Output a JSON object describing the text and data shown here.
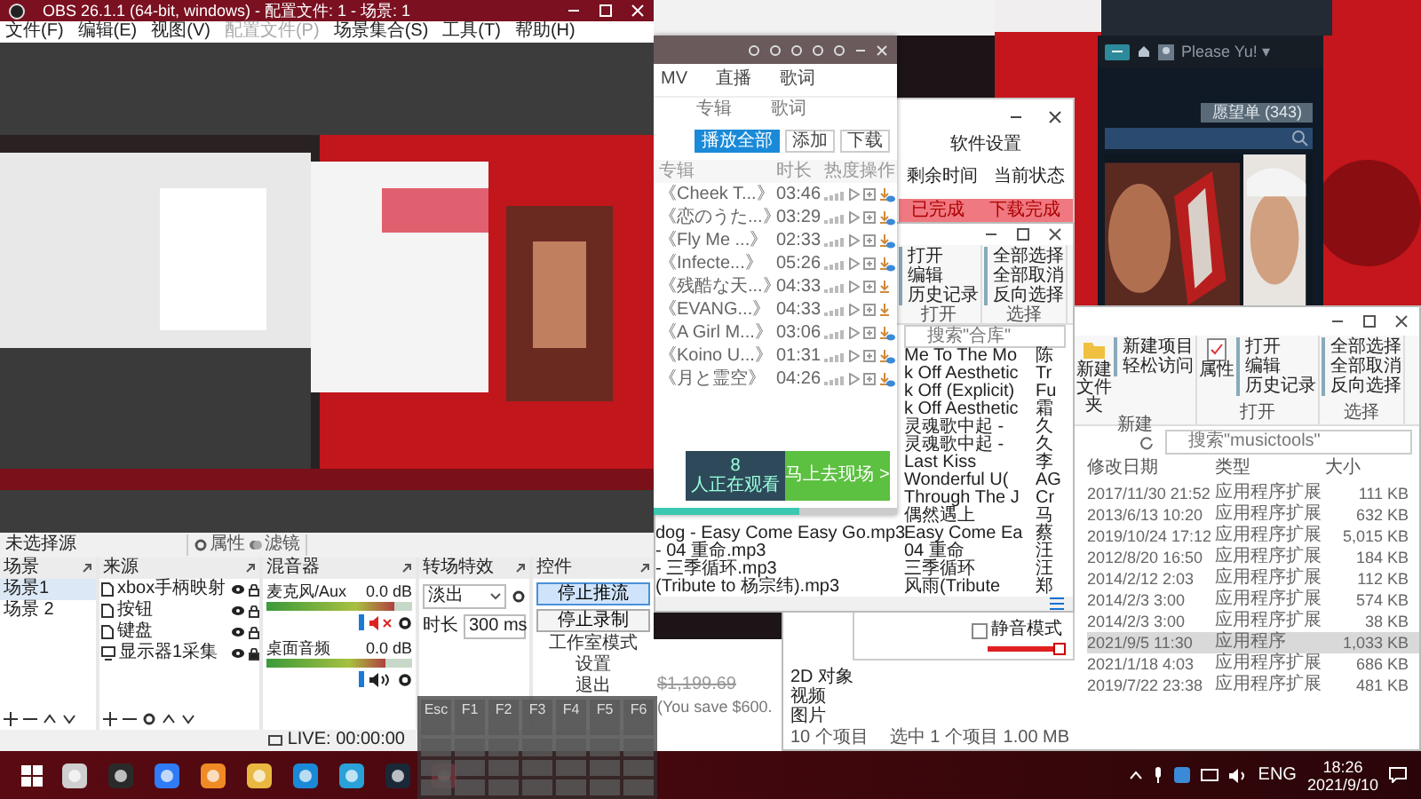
{
  "obs": {
    "title": "OBS 26.1.1 (64-bit, windows) - 配置文件: 1 - 场景: 1",
    "menu": [
      {
        "label": "文件(F)",
        "disabled": false
      },
      {
        "label": "编辑(E)",
        "disabled": false
      },
      {
        "label": "视图(V)",
        "disabled": false
      },
      {
        "label": "配置文件(P)",
        "disabled": true
      },
      {
        "label": "场景集合(S)",
        "disabled": false
      },
      {
        "label": "工具(T)",
        "disabled": false
      },
      {
        "label": "帮助(H)",
        "disabled": false
      }
    ],
    "source_toolbar": {
      "label": "未选择源",
      "properties": "属性",
      "filters": "滤镜"
    },
    "scenes": {
      "title": "场景",
      "items": [
        {
          "label": "场景1",
          "selected": true
        },
        {
          "label": "场景 2",
          "selected": false
        }
      ]
    },
    "sources": {
      "title": "来源",
      "items": [
        {
          "label": "xbox手柄映射",
          "kind": "file",
          "locked": false
        },
        {
          "label": "按钮",
          "kind": "file",
          "locked": false
        },
        {
          "label": "键盘",
          "kind": "file",
          "locked": false
        },
        {
          "label": "显示器1采集",
          "kind": "monitor",
          "locked": true
        }
      ]
    },
    "mixer": {
      "title": "混音器",
      "channels": [
        {
          "name": "麦克风/Aux",
          "reading": "0.0 dB",
          "level": 0.88,
          "muted": true
        },
        {
          "name": "桌面音频",
          "reading": "0.0 dB",
          "level": 0.82,
          "muted": false
        }
      ]
    },
    "transitions": {
      "title": "转场特效",
      "effect": "淡出",
      "duration_label": "时长",
      "duration": "300 ms"
    },
    "controls": {
      "title": "控件",
      "buttons": [
        {
          "label": "停止推流",
          "selected": true
        },
        {
          "label": "停止录制",
          "selected": false
        }
      ],
      "menu": [
        "工作室模式",
        "设置",
        "退出"
      ]
    },
    "status": {
      "live": "LIVE: 00:00:00"
    }
  },
  "keyboard": {
    "keys": [
      "Esc",
      "F1",
      "F2",
      "F3",
      "F4",
      "F5",
      "F6"
    ]
  },
  "player": {
    "tabs": [
      {
        "label": "MV",
        "selected": false
      },
      {
        "label": "直播",
        "selected": false
      },
      {
        "label": "歌词",
        "selected": false
      }
    ],
    "subtabs": [
      "专辑",
      "歌词"
    ],
    "actions": [
      {
        "label": "播放全部",
        "kind": "primary"
      },
      {
        "label": "添加",
        "kind": "plain"
      },
      {
        "label": "下载",
        "kind": "plain"
      }
    ],
    "columns": [
      "专辑",
      "时长",
      "热度",
      "操作"
    ],
    "rows": [
      {
        "album": "《Cheek T...》",
        "duration": "03:46",
        "downloaded": true
      },
      {
        "album": "《恋のうた...》",
        "duration": "03:29",
        "downloaded": true
      },
      {
        "album": "《Fly Me ...》",
        "duration": "02:33",
        "downloaded": true
      },
      {
        "album": "《Infecte...》",
        "duration": "05:26",
        "downloaded": true
      },
      {
        "album": "《残酷な天...》",
        "duration": "04:33",
        "downloaded": false
      },
      {
        "album": "《EVANG...》",
        "duration": "04:33",
        "downloaded": false
      },
      {
        "album": "《A Girl M...》",
        "duration": "03:06",
        "downloaded": true
      },
      {
        "album": "《Koino U...》",
        "duration": "01:31",
        "downloaded": true
      },
      {
        "album": "《月と霊空》",
        "duration": "04:26",
        "downloaded": true
      }
    ],
    "live": {
      "count": "8",
      "label": "人正在观看",
      "cta": "马上去现场 >"
    },
    "progress": {
      "level": 0.6
    }
  },
  "settings": {
    "title": "软件设置",
    "columns": [
      "剩余时间",
      "当前状态"
    ],
    "row": [
      "已完成",
      "下载完成"
    ],
    "mute": {
      "label": "静音模式",
      "checked": false
    },
    "volume": {
      "level": 0.95
    }
  },
  "explorer_music": {
    "open_group": {
      "label": "打开",
      "items": [
        "打开",
        "编辑",
        "历史记录"
      ]
    },
    "select_group": {
      "label": "选择",
      "items": [
        "全部选择",
        "全部取消",
        "反向选择"
      ]
    },
    "search": {
      "placeholder": "搜索\"合库\""
    },
    "rows": [
      {
        "title": "Me To The Mo",
        "artist": "陈"
      },
      {
        "title": "k Off Aesthetic",
        "artist": "Tr"
      },
      {
        "title": "k Off (Explicit)",
        "artist": "Fu"
      },
      {
        "title": "k Off Aesthetic",
        "artist": "霜"
      },
      {
        "title": "灵魂歌中起 -",
        "artist": "久"
      },
      {
        "title": "灵魂歌中起 -",
        "artist": "久"
      },
      {
        "title": "Last Kiss",
        "artist": "李"
      },
      {
        "title": "Wonderful U(",
        "artist": "AG"
      },
      {
        "title": "Through The J",
        "artist": "Cr"
      },
      {
        "title": "偶然遇上",
        "artist": "马"
      },
      {
        "file": "dog - Easy Come Easy Go.mp3",
        "title": "Easy Come Ea",
        "artist": "蔡"
      },
      {
        "file": "- 04 重命.mp3",
        "title": "04 重命",
        "artist": "汪"
      },
      {
        "file": "- 三季循环.mp3",
        "title": "三季循环",
        "artist": "汪"
      },
      {
        "file": "(Tribute to 杨宗纬).mp3",
        "title": "风雨(Tribute",
        "artist": "郑"
      }
    ]
  },
  "explorer_tools": {
    "new_group": {
      "label": "新建",
      "big": "新建文件夹",
      "items": [
        "新建项目",
        "轻松访问"
      ]
    },
    "open_group": {
      "label": "打开",
      "big": "属性",
      "items": [
        "打开",
        "编辑",
        "历史记录"
      ]
    },
    "select_group": {
      "label": "选择",
      "items": [
        "全部选择",
        "全部取消",
        "反向选择"
      ]
    },
    "search": {
      "placeholder": "搜索\"musictools\""
    },
    "columns": [
      "修改日期",
      "类型",
      "大小"
    ],
    "rows": [
      {
        "date": "2017/11/30 21:52",
        "type": "应用程序扩展",
        "size": "111 KB",
        "selected": false
      },
      {
        "date": "2013/6/13 10:20",
        "type": "应用程序扩展",
        "size": "632 KB",
        "selected": false
      },
      {
        "date": "2019/10/24 17:12",
        "type": "应用程序扩展",
        "size": "5,015 KB",
        "selected": false
      },
      {
        "date": "2012/8/20 16:50",
        "type": "应用程序扩展",
        "size": "184 KB",
        "selected": false
      },
      {
        "date": "2014/2/12 2:03",
        "type": "应用程序扩展",
        "size": "112 KB",
        "selected": false
      },
      {
        "date": "2014/2/3 3:00",
        "type": "应用程序扩展",
        "size": "574 KB",
        "selected": false
      },
      {
        "date": "2014/2/3 3:00",
        "type": "应用程序扩展",
        "size": "38 KB",
        "selected": false
      },
      {
        "date": "2021/9/5 11:30",
        "type": "应用程序",
        "size": "1,033 KB",
        "selected": true
      },
      {
        "date": "2021/1/18 4:03",
        "type": "应用程序扩展",
        "size": "686 KB",
        "selected": false
      },
      {
        "date": "2019/7/22 23:38",
        "type": "应用程序扩展",
        "size": "481 KB",
        "selected": false
      }
    ],
    "nav": [
      "2D 对象",
      "视频",
      "图片"
    ],
    "status": {
      "count": "10 个项目",
      "selection": "选中 1 个项目  1.00 MB"
    }
  },
  "steam": {
    "user": "Please Yu! ▾",
    "wishlist": "愿望单 (343)"
  },
  "web_page": {
    "old_price": "$1,199.69",
    "saving": "(You save $600."
  },
  "taskbar": {
    "language": "ENG",
    "time": "18:26",
    "date": "2021/9/10"
  }
}
